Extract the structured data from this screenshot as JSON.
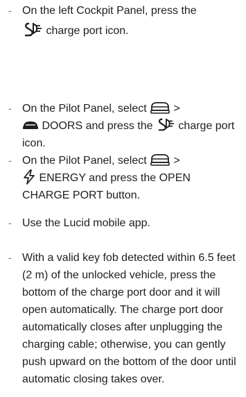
{
  "instructions": [
    {
      "bullet": "-",
      "line1": "On the left Cockpit Panel, press the",
      "text_after_icon": " charge port icon."
    },
    {
      "bullet": "-",
      "text_before_car_icon": "On the Pilot Panel, select ",
      "after_car_icon": " >",
      "doors_label": " DOORS and press the ",
      "text_after_charge_icon": " charge port icon."
    },
    {
      "bullet": "-",
      "text_before_car_icon": "On the Pilot Panel, select ",
      "after_car_icon": " >",
      "energy_label": " ENERGY and press the OPEN CHARGE PORT button."
    },
    {
      "bullet": "-",
      "text": "Use the Lucid mobile app."
    },
    {
      "bullet": "-",
      "text": "With a valid key fob detected within 6.5 feet (2 m) of the unlocked vehicle, press the bottom of the charge port door and it will open automatically. The charge port door automatically closes after unplugging the charging cable; otherwise, you can gently push upward on the bottom of the door until automatic closing takes over."
    }
  ],
  "icons": {
    "charge_port": "charge-port-icon",
    "car_menu": "car-menu-icon",
    "doors": "doors-icon",
    "energy": "lightning-icon"
  },
  "colors": {
    "text": "#1e1e1e",
    "bullet": "#6a6a6a"
  }
}
